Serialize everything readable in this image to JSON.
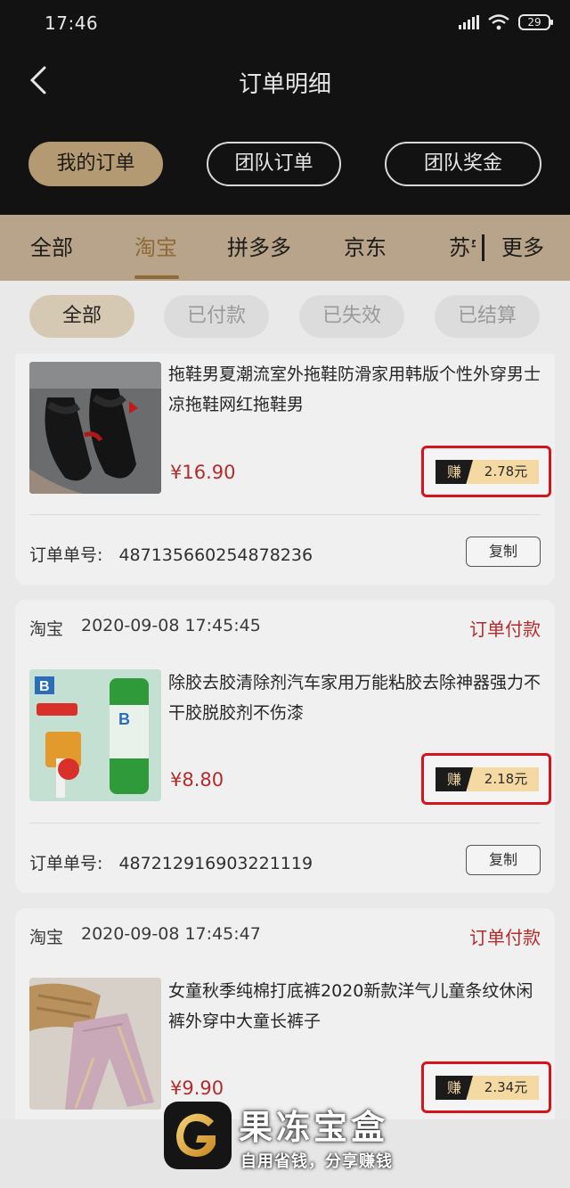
{
  "status_bar": {
    "time": "17:46",
    "battery": "29"
  },
  "header": {
    "title": "订单明细"
  },
  "segments": [
    {
      "label": "我的订单",
      "active": true
    },
    {
      "label": "团队订单",
      "active": false
    },
    {
      "label": "团队奖金",
      "active": false
    }
  ],
  "platform_tabs": [
    {
      "label": "全部",
      "active": false
    },
    {
      "label": "淘宝",
      "active": true
    },
    {
      "label": "拼多多",
      "active": false
    },
    {
      "label": "京东",
      "active": false
    },
    {
      "label": "苏宁",
      "active": false
    }
  ],
  "more_label": "更多",
  "filters": [
    {
      "label": "全部",
      "active": true
    },
    {
      "label": "已付款",
      "active": false
    },
    {
      "label": "已失效",
      "active": false
    },
    {
      "label": "已结算",
      "active": false
    }
  ],
  "orders": [
    {
      "platform": "",
      "time": "",
      "status": "",
      "product": "拖鞋男夏潮流室外拖鞋防滑家用韩版个性外穿男士凉拖鞋网红拖鞋男",
      "price": "¥16.90",
      "earn_tag": "赚",
      "earn_amount": "2.78元",
      "order_no_label": "订单单号:",
      "order_no": "487135660254878236",
      "copy_label": "复制",
      "thumb_icon": "slipper-product-image"
    },
    {
      "platform": "淘宝",
      "time": "2020-09-08 17:45:45",
      "status": "订单付款",
      "product": "除胶去胶清除剂汽车家用万能粘胶去除神器强力不干胶脱胶剂不伤漆",
      "price": "¥8.80",
      "earn_tag": "赚",
      "earn_amount": "2.18元",
      "order_no_label": "订单单号:",
      "order_no": "487212916903221119",
      "copy_label": "复制",
      "thumb_icon": "glue-remover-product-image"
    },
    {
      "platform": "淘宝",
      "time": "2020-09-08 17:45:47",
      "status": "订单付款",
      "product": "女童秋季纯棉打底裤2020新款洋气儿童条纹休闲裤外穿中大童长裤子",
      "price": "¥9.90",
      "earn_tag": "赚",
      "earn_amount": "2.34元",
      "order_no_label": "",
      "order_no": "",
      "copy_label": "",
      "thumb_icon": "kids-pants-product-image"
    }
  ],
  "brand": {
    "name": "果冻宝盒",
    "slogan": "自用省钱，分享赚钱",
    "logo_letter": "G"
  }
}
